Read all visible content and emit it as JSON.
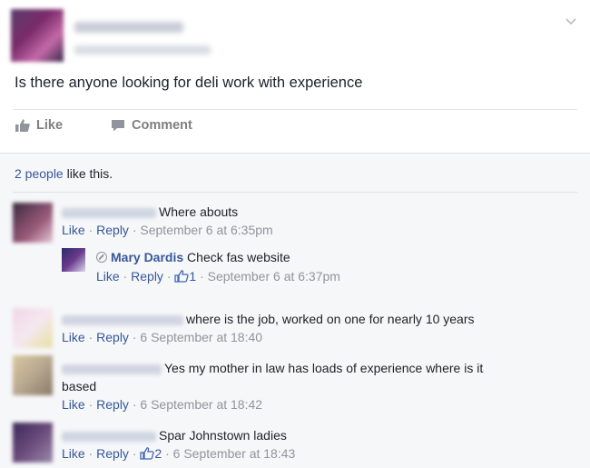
{
  "post": {
    "text": "Is there anyone looking for deli work with experience",
    "actions": {
      "like": "Like",
      "comment": "Comment"
    },
    "likes": {
      "count_link": "2 people",
      "suffix": " like this."
    }
  },
  "comments": [
    {
      "text": "Where abouts",
      "like": "Like",
      "reply": "Reply",
      "timestamp": "September 6 at 6:35pm",
      "replies": [
        {
          "author": "Mary Dardis",
          "text": "Check fas website",
          "like": "Like",
          "reply": "Reply",
          "like_count": "1",
          "timestamp": "September 6 at 6:37pm"
        }
      ]
    },
    {
      "text": "where is the job, worked on one for nearly 10 years",
      "like": "Like",
      "reply": "Reply",
      "timestamp": "6 September at 18:40"
    },
    {
      "text_line1": "Yes my mother in law has loads of experience where is it",
      "text_line2": "based",
      "like": "Like",
      "reply": "Reply",
      "timestamp": "6 September at 18:42"
    },
    {
      "text": "Spar Johnstown ladies",
      "like": "Like",
      "reply": "Reply",
      "like_count": "2",
      "timestamp": "6 September at 18:43"
    }
  ],
  "icons": {
    "like": "thumbs-up-icon",
    "comment": "speech-bubble-icon",
    "menu": "chevron-down-icon"
  },
  "colors": {
    "link": "#365899",
    "meta": "#90949c",
    "action": "#7f7f7f",
    "comments_bg": "#f6f7f9"
  }
}
